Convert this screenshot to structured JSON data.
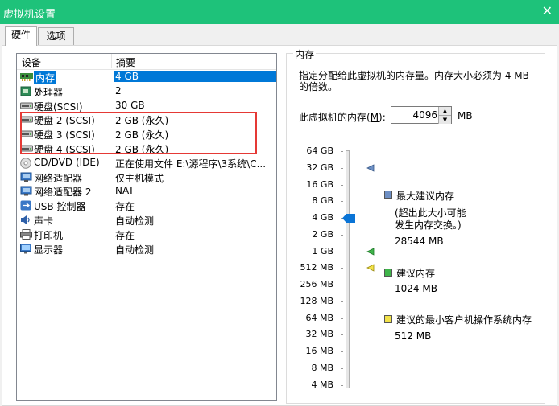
{
  "window": {
    "title": "虚拟机设置"
  },
  "tabs": [
    {
      "label": "硬件"
    },
    {
      "label": "选项"
    }
  ],
  "device_list": {
    "headers": {
      "device": "设备",
      "summary": "摘要"
    },
    "rows": [
      {
        "device": "内存",
        "summary": "4 GB",
        "icon": "memory-icon"
      },
      {
        "device": "处理器",
        "summary": "2",
        "icon": "processor-icon"
      },
      {
        "device": "硬盘(SCSI)",
        "summary": "30 GB",
        "icon": "hard-disk-icon"
      },
      {
        "device": "硬盘 2 (SCSI)",
        "summary": "2 GB (永久)",
        "icon": "hard-disk-icon"
      },
      {
        "device": "硬盘 3 (SCSI)",
        "summary": "2 GB (永久)",
        "icon": "hard-disk-icon"
      },
      {
        "device": "硬盘 4 (SCSI)",
        "summary": "2 GB (永久)",
        "icon": "hard-disk-icon"
      },
      {
        "device": "CD/DVD (IDE)",
        "summary": "正在使用文件 E:\\源程序\\3系统\\C...",
        "icon": "cd-dvd-icon"
      },
      {
        "device": "网络适配器",
        "summary": "仅主机模式",
        "icon": "network-adapter-icon"
      },
      {
        "device": "网络适配器 2",
        "summary": "NAT",
        "icon": "network-adapter-icon"
      },
      {
        "device": "USB 控制器",
        "summary": "存在",
        "icon": "usb-icon"
      },
      {
        "device": "声卡",
        "summary": "自动检测",
        "icon": "sound-card-icon"
      },
      {
        "device": "打印机",
        "summary": "存在",
        "icon": "printer-icon"
      },
      {
        "device": "显示器",
        "summary": "自动检测",
        "icon": "display-icon"
      }
    ]
  },
  "memory": {
    "group_title": "内存",
    "description": "指定分配给此虚拟机的内存量。内存大小必须为 4 MB 的倍数。",
    "label_prefix": "此虚拟机的内存(",
    "label_key": "M",
    "label_suffix": "):",
    "value": "4096",
    "unit": "MB",
    "scale": [
      "64 GB",
      "32 GB",
      "16 GB",
      "8 GB",
      "4 GB",
      "2 GB",
      "1 GB",
      "512 MB",
      "256 MB",
      "128 MB",
      "64 MB",
      "32 MB",
      "16 MB",
      "8 MB",
      "4 MB"
    ],
    "current_level": "4 GB",
    "legend": {
      "max": {
        "title": "最大建议内存",
        "note_line1": "(超出此大小可能",
        "note_line2": "发生内存交换。)",
        "value": "28544 MB",
        "color": "#6d8fc4",
        "level": "32 GB"
      },
      "recommended": {
        "title": "建议内存",
        "value": "1024 MB",
        "color": "#3fb44a",
        "level": "1 GB"
      },
      "min_guest": {
        "title": "建议的最小客户机操作系统内存",
        "value": "512 MB",
        "color": "#f2e24a",
        "level": "512 MB"
      }
    }
  }
}
